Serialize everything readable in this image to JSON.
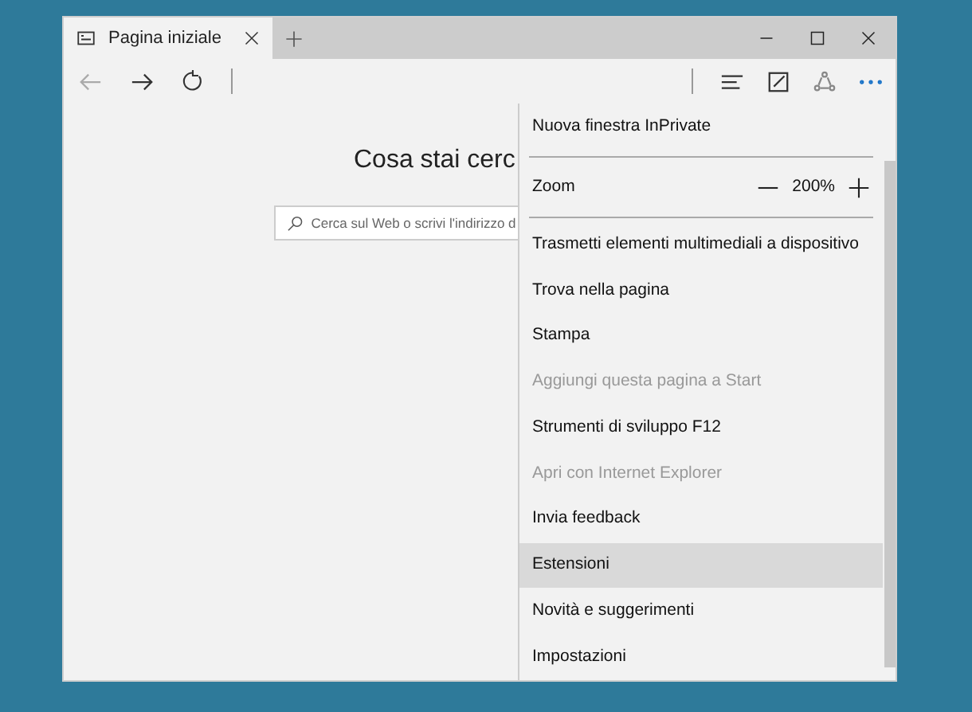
{
  "tab": {
    "title": "Pagina iniziale",
    "selected": true
  },
  "page": {
    "heading": "Cosa stai cerc",
    "search": {
      "placeholder": "Cerca sul Web o scrivi l'indirizzo d"
    }
  },
  "menu": {
    "items": [
      {
        "kind": "action",
        "label": "Nuova finestra InPrivate",
        "disabled": false,
        "selected": false
      },
      {
        "kind": "divider"
      },
      {
        "kind": "zoom",
        "label": "Zoom",
        "reading": "200%"
      },
      {
        "kind": "divider"
      },
      {
        "kind": "action",
        "label": "Trasmetti elementi multimediali a dispositivo",
        "disabled": false,
        "selected": false
      },
      {
        "kind": "action",
        "label": "Trova nella pagina",
        "disabled": false,
        "selected": false
      },
      {
        "kind": "action",
        "label": "Stampa",
        "disabled": false,
        "selected": false
      },
      {
        "kind": "action",
        "label": "Aggiungi questa pagina a Start",
        "disabled": true,
        "selected": false
      },
      {
        "kind": "action",
        "label": "Strumenti di sviluppo F12",
        "disabled": false,
        "selected": false
      },
      {
        "kind": "action",
        "label": "Apri con Internet Explorer",
        "disabled": true,
        "selected": false
      },
      {
        "kind": "action",
        "label": "Invia feedback",
        "disabled": false,
        "selected": false
      },
      {
        "kind": "action",
        "label": "Estensioni",
        "disabled": false,
        "selected": true
      },
      {
        "kind": "action",
        "label": "Novità e suggerimenti",
        "disabled": false,
        "selected": false
      },
      {
        "kind": "action",
        "label": "Impostazioni",
        "disabled": false,
        "selected": false
      }
    ]
  }
}
